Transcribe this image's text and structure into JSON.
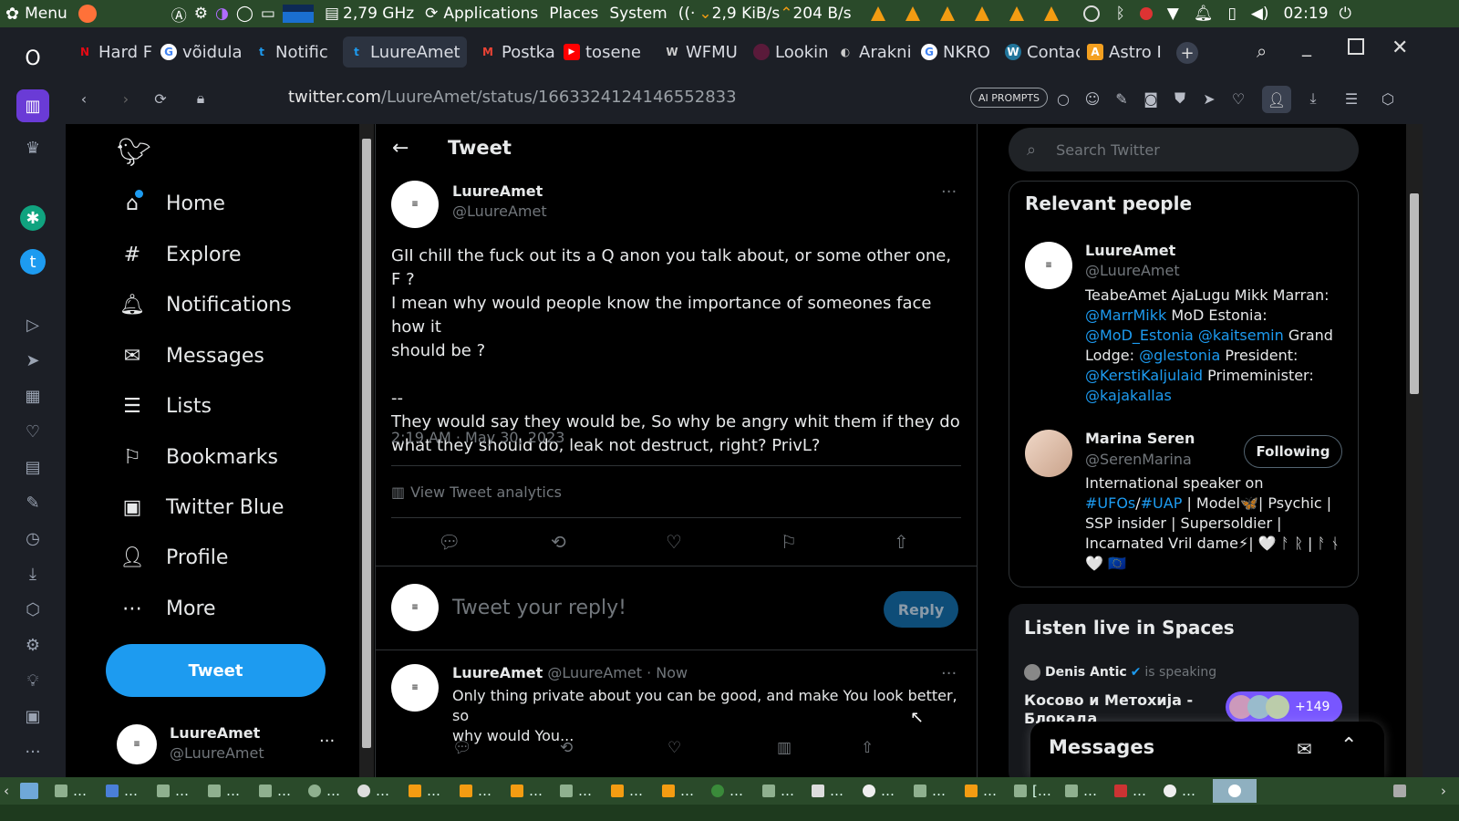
{
  "system_panel": {
    "menu_label": "Menu",
    "cpu_freq": "2,79 GHz",
    "applications": "Applications",
    "places": "Places",
    "system": "System",
    "net_down": "2,9 KiB/s",
    "net_up": "204 B/s",
    "clock": "02:19"
  },
  "tabs": [
    {
      "label": "Hard F",
      "color": "#e50914",
      "glyph": "N"
    },
    {
      "label": "võidula",
      "color": "#ffffff",
      "glyph": "G"
    },
    {
      "label": "Notific",
      "color": "#1d9bf0",
      "glyph": "t"
    },
    {
      "label": "LuureAmet",
      "color": "#1d9bf0",
      "glyph": "t"
    },
    {
      "label": "Postka",
      "color": "#ea4335",
      "glyph": "M"
    },
    {
      "label": "tosene",
      "color": "#ff0000",
      "glyph": "▶"
    },
    {
      "label": "WFMU",
      "color": "#555555",
      "glyph": "W"
    },
    {
      "label": "Lookin",
      "color": "#5a1a3a",
      "glyph": "•"
    },
    {
      "label": "Arakni",
      "color": "#888888",
      "glyph": "◐"
    },
    {
      "label": "NKRO",
      "color": "#ffffff",
      "glyph": "G"
    },
    {
      "label": "Contac",
      "color": "#21759b",
      "glyph": "W"
    },
    {
      "label": "Astro I",
      "color": "#f4a020",
      "glyph": "A"
    }
  ],
  "address": {
    "host": "twitter.com",
    "path": "/LuureAmet/status/1663324124146552833",
    "ai_prompts": "AI PROMPTS"
  },
  "nav": {
    "home": "Home",
    "explore": "Explore",
    "notifications": "Notifications",
    "messages": "Messages",
    "lists": "Lists",
    "bookmarks": "Bookmarks",
    "twitter_blue": "Twitter Blue",
    "profile": "Profile",
    "more": "More",
    "tweet_button": "Tweet",
    "account_name": "LuureAmet",
    "account_handle": "@LuureAmet"
  },
  "tweet": {
    "header": "Tweet",
    "author_name": "LuureAmet",
    "author_handle": "@LuureAmet",
    "line1": "GII chill the fuck out its a Q anon you talk about, or some other one, F ?",
    "line2": "I mean why would people know the importance of someones face how it",
    "line3": "should be ?",
    "line4": "--",
    "line5": "They would say they would be, So why be angry whit them if they do",
    "line6": "what they should do, leak not destruct, right? PrivL?",
    "timestamp": "2:19 AM · May 30, 2023",
    "analytics": "View Tweet analytics",
    "reply_placeholder": "Tweet your reply!",
    "reply_button": "Reply"
  },
  "reply": {
    "name": "LuureAmet",
    "handle": "@LuureAmet",
    "time": "· Now",
    "line1": "Only thing private about you can be good, and make You look better, so",
    "line2": "why would You..."
  },
  "right": {
    "search_placeholder": "Search Twitter",
    "relevant_title": "Relevant people",
    "p1_name": "LuureAmet",
    "p1_handle": "@LuureAmet",
    "p1_bio_a": "TeabeAmet AjaLugu Mikk Marran:",
    "p1_bio_b1": "@MarrMikk",
    "p1_bio_b2": " MoD Estonia:",
    "p1_bio_c1": "@MoD_Estonia",
    "p1_bio_c2": "@kaitsemin",
    "p1_bio_c3": " Grand",
    "p1_bio_d1": "Lodge: ",
    "p1_bio_d2": "@glestonia",
    "p1_bio_d3": " President:",
    "p1_bio_e1": "@KerstiKaljulaid",
    "p1_bio_e2": " Primeminister:",
    "p1_bio_f": "@kajakallas",
    "p2_name": "Marina Seren",
    "p2_handle": "@SerenMarina",
    "p2_follow": "Following",
    "p2_bio_a": "International speaker on",
    "p2_bio_b1": "#UFOs",
    "p2_bio_b2": "/",
    "p2_bio_b3": "#UAP",
    "p2_bio_b4": " | Model🦋| Psychic |",
    "p2_bio_c": "SSP insider | Supersoldier |",
    "p2_bio_d": "Incarnated Vril dame⚡| 🤍 ᚨ ᚱ | ᚨ ᚾ",
    "p2_bio_e": "🤍 🇪🇺",
    "spaces_title": "Listen live in Spaces",
    "space_host": "Denis Antic",
    "space_status": "is speaking",
    "space_title": "Косово и Метохија -",
    "space_title2": "Блокада",
    "space_count": "+149",
    "messages_title": "Messages"
  },
  "colors": {
    "accent": "#1d9bf0",
    "background": "#000000",
    "panel": "#2a4a2a"
  }
}
